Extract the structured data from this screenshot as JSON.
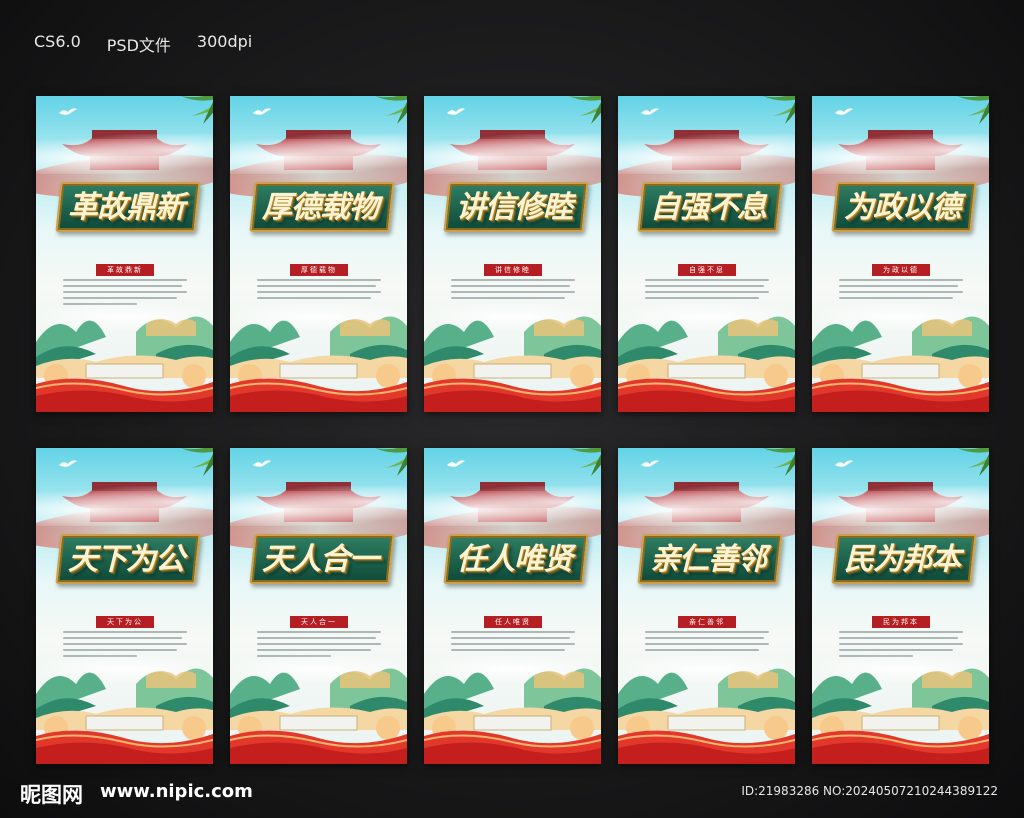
{
  "header": {
    "version": "CS6.0",
    "format": "PSD文件",
    "resolution": "300dpi"
  },
  "posters": [
    {
      "title": "革故鼎新",
      "tag": "革故鼎新",
      "lines": 5
    },
    {
      "title": "厚德载物",
      "tag": "厚德载物",
      "lines": 4
    },
    {
      "title": "讲信修睦",
      "tag": "讲信修睦",
      "lines": 4
    },
    {
      "title": "自强不息",
      "tag": "自强不息",
      "lines": 4
    },
    {
      "title": "为政以德",
      "tag": "为政以德",
      "lines": 4
    },
    {
      "title": "天下为公",
      "tag": "天下为公",
      "lines": 5
    },
    {
      "title": "天人合一",
      "tag": "天人合一",
      "lines": 5
    },
    {
      "title": "任人唯贤",
      "tag": "任人唯贤",
      "lines": 4
    },
    {
      "title": "亲仁善邻",
      "tag": "亲仁善邻",
      "lines": 4
    },
    {
      "title": "民为邦本",
      "tag": "民为邦本",
      "lines": 5
    }
  ],
  "footer": {
    "logo": "昵图网",
    "url": "www.nipic.com",
    "id_text": "ID:21983286 NO:20240507210244389122"
  },
  "colors": {
    "accent_red": "#b51e22",
    "title_green": "#1e5a45",
    "gold": "#caa24a"
  }
}
